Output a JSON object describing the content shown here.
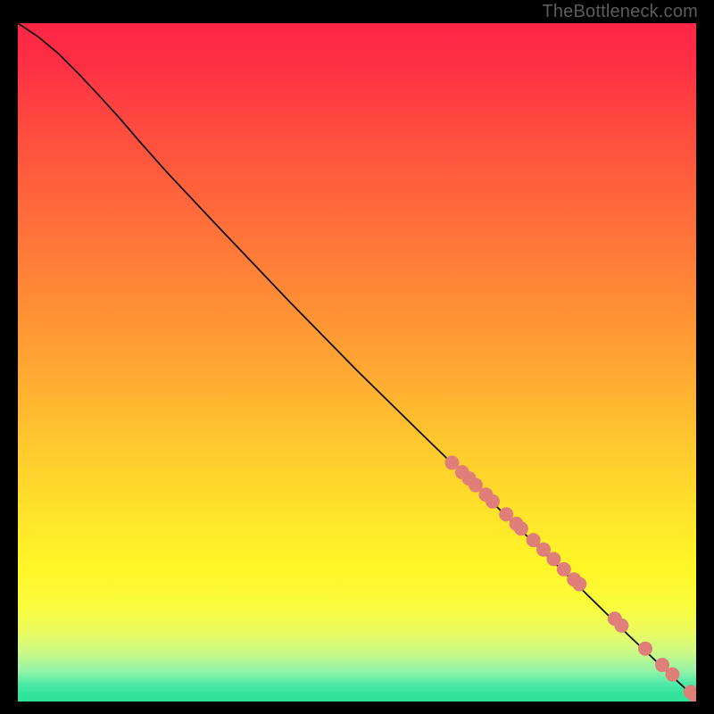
{
  "attribution": "TheBottleneck.com",
  "colors": {
    "curve": "#101010",
    "marker_fill": "#e07e7a",
    "marker_stroke": "#c96a66"
  },
  "chart_data": {
    "type": "line",
    "title": "",
    "xlabel": "",
    "ylabel": "",
    "x": [
      0.0,
      0.03,
      0.06,
      0.09,
      0.12,
      0.15,
      0.18,
      0.22,
      0.3,
      0.4,
      0.5,
      0.6,
      0.7,
      0.8,
      0.9,
      1.0
    ],
    "y": [
      1.0,
      0.98,
      0.955,
      0.925,
      0.893,
      0.86,
      0.825,
      0.78,
      0.695,
      0.59,
      0.488,
      0.39,
      0.293,
      0.196,
      0.098,
      0.004
    ],
    "xlim": [
      0,
      1
    ],
    "ylim": [
      0,
      1
    ],
    "markers_x": [
      0.64,
      0.655,
      0.665,
      0.675,
      0.69,
      0.7,
      0.72,
      0.735,
      0.742,
      0.76,
      0.775,
      0.79,
      0.805,
      0.82,
      0.828,
      0.88,
      0.89,
      0.925,
      0.95,
      0.965,
      0.992,
      0.998,
      1.005
    ],
    "markers_y": [
      0.352,
      0.338,
      0.329,
      0.319,
      0.305,
      0.295,
      0.276,
      0.262,
      0.255,
      0.238,
      0.224,
      0.21,
      0.195,
      0.18,
      0.173,
      0.122,
      0.112,
      0.078,
      0.054,
      0.04,
      0.014,
      0.009,
      0.004
    ],
    "marker_radius": 8
  }
}
